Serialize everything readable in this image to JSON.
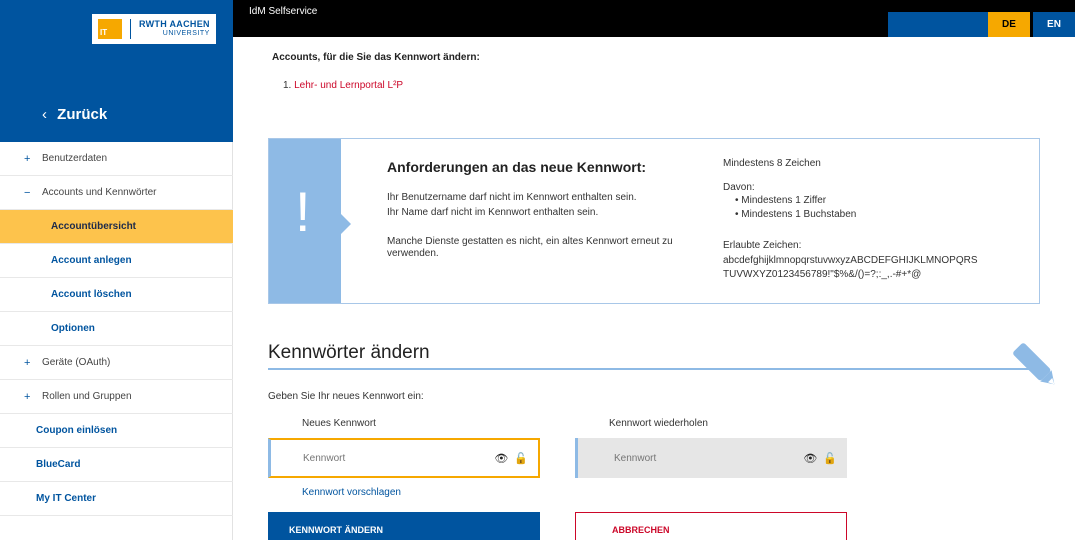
{
  "app": {
    "title": "IdM Selfservice",
    "lang_de": "DE",
    "lang_en": "EN",
    "logo_top": "RWTH AACHEN",
    "logo_bottom": "UNIVERSITY",
    "logo_it": "IT"
  },
  "sidebar": {
    "back_label": "Zurück",
    "items": [
      {
        "label": "Benutzerdaten",
        "symbol": "+"
      },
      {
        "label": "Accounts und Kennwörter",
        "symbol": "−"
      },
      {
        "label": "Accountübersicht"
      },
      {
        "label": "Account anlegen"
      },
      {
        "label": "Account löschen"
      },
      {
        "label": "Optionen"
      },
      {
        "label": "Geräte (OAuth)",
        "symbol": "+"
      },
      {
        "label": "Rollen und Gruppen",
        "symbol": "+"
      },
      {
        "label": "Coupon einlösen"
      },
      {
        "label": "BlueCard"
      },
      {
        "label": "My IT Center"
      }
    ]
  },
  "accounts": {
    "heading": "Accounts, für die Sie das Kennwort ändern:",
    "items": [
      {
        "number": "1.",
        "label": "Lehr- und Lernportal L²P"
      }
    ]
  },
  "requirements": {
    "title": "Anforderungen an das neue Kennwort:",
    "rules": [
      "Ihr Benutzername darf nicht im Kennwort enthalten sein.",
      "Ihr Name darf nicht im Kennwort enthalten sein.",
      "Manche Dienste gestatten es nicht, ein altes Kennwort erneut zu verwenden."
    ],
    "min_length": "Mindestens 8 Zeichen",
    "davon": "Davon:",
    "bullets": [
      "Mindestens 1 Ziffer",
      "Mindestens 1 Buchstaben"
    ],
    "allowed_label": "Erlaubte Zeichen:",
    "allowed_line1": "abcdefghijklmnopqrstuvwxyzABCDEFGHIJKLMNOPQRS",
    "allowed_line2": "TUVWXYZ0123456789!\"$%&/()=?;:_,.-#+*@"
  },
  "form": {
    "section_title": "Kennwörter ändern",
    "prompt": "Geben Sie Ihr neues Kennwort ein:",
    "new_label": "Neues Kennwort",
    "new_placeholder": "Kennwort",
    "repeat_label": "Kennwort wiederholen",
    "repeat_placeholder": "Kennwort",
    "suggest_link": "Kennwort vorschlagen",
    "submit_label": "KENNWORT ÄNDERN",
    "cancel_label": "ABBRECHEN"
  },
  "colors": {
    "brand_blue": "#00549f",
    "accent_yellow": "#f6a800",
    "light_blue": "#8ebae5",
    "danger_red": "#cc0729"
  }
}
